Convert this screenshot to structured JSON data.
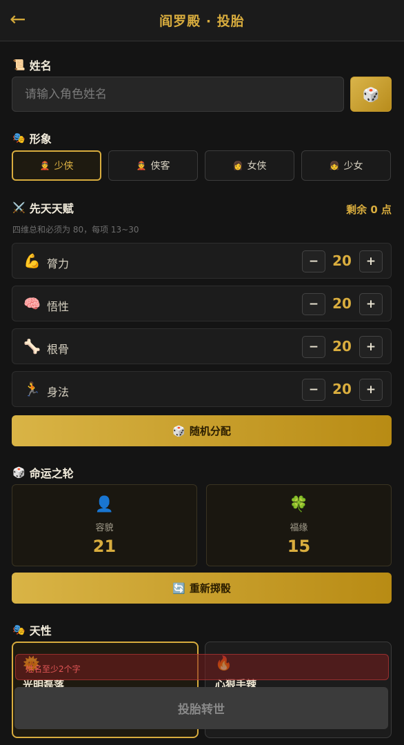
{
  "header": {
    "title": "阎罗殿 · 投胎",
    "back_icon": "←"
  },
  "name_section": {
    "icon": "📜",
    "title": "姓名",
    "placeholder": "请输入角色姓名",
    "value": "",
    "random_icon": "🎲"
  },
  "appearance": {
    "icon": "🎭",
    "title": "形象",
    "options": [
      {
        "icon": "👲",
        "label": "少侠",
        "selected": true
      },
      {
        "icon": "👲",
        "label": "侠客",
        "selected": false
      },
      {
        "icon": "👩",
        "label": "女侠",
        "selected": false
      },
      {
        "icon": "👧",
        "label": "少女",
        "selected": false
      }
    ]
  },
  "talent": {
    "icon": "⚔️",
    "title": "先天天赋",
    "remaining": "剩余 0 点",
    "hint": "四维总和必须为 80，每项 13~30",
    "stats": [
      {
        "icon": "💪",
        "label": "膂力",
        "value": 20
      },
      {
        "icon": "🧠",
        "label": "悟性",
        "value": 20
      },
      {
        "icon": "🦴",
        "label": "根骨",
        "value": 20
      },
      {
        "icon": "🏃",
        "label": "身法",
        "value": 20
      }
    ],
    "minus": "−",
    "plus": "+",
    "random_button": {
      "icon": "🎲",
      "label": "随机分配"
    }
  },
  "fate": {
    "icon": "🎲",
    "title": "命运之轮",
    "cards": [
      {
        "icon": "👤",
        "label": "容貌",
        "value": 21
      },
      {
        "icon": "🍀",
        "label": "福缘",
        "value": 15
      }
    ],
    "reroll_button": {
      "icon": "🔄",
      "label": "重新掷骰"
    }
  },
  "nature": {
    "icon": "🎭",
    "title": "天性",
    "traits": [
      {
        "icon": "🌞",
        "name": "光明磊落",
        "selected": true
      },
      {
        "icon": "🔥",
        "name": "心狠手辣",
        "selected": false
      }
    ]
  },
  "error_toast": "姓名至少2个字",
  "submit_label": "投胎转世",
  "colors": {
    "accent": "#d9ad3e",
    "background": "#141414",
    "error": "#e25656"
  }
}
